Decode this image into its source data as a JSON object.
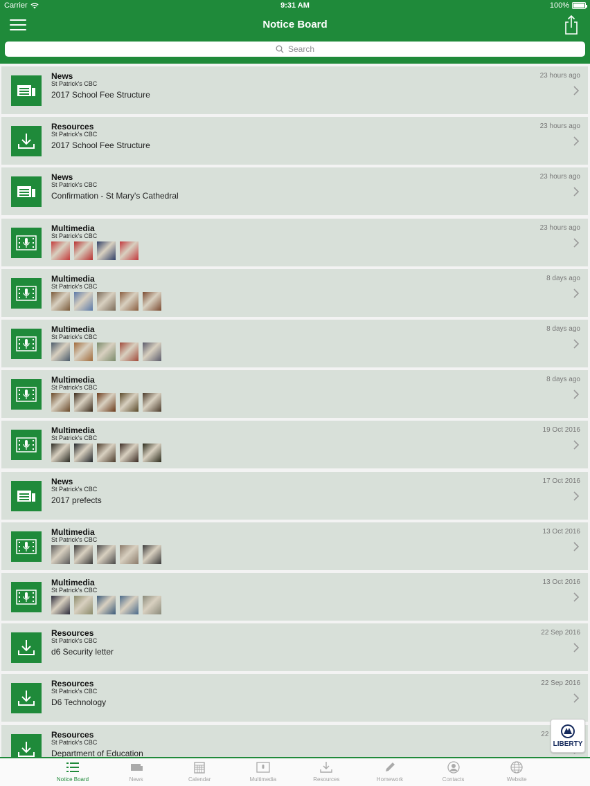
{
  "status": {
    "carrier": "Carrier",
    "time": "9:31 AM",
    "battery": "100%"
  },
  "nav": {
    "title": "Notice Board"
  },
  "search": {
    "placeholder": "Search"
  },
  "colors": {
    "brand": "#1f8a3a",
    "row_bg": "#d8e0d9"
  },
  "items": [
    {
      "type": "News",
      "icon": "news-icon",
      "source": "St Patrick's CBC",
      "title": "2017 School Fee Structure",
      "time": "23 hours ago"
    },
    {
      "type": "Resources",
      "icon": "download-icon",
      "source": "St Patrick's CBC",
      "title": "2017 School Fee Structure",
      "time": "23 hours ago"
    },
    {
      "type": "News",
      "icon": "news-icon",
      "source": "St Patrick's CBC",
      "title": "Confirmation - St Mary's Cathedral",
      "time": "23 hours ago"
    },
    {
      "type": "Multimedia",
      "icon": "multimedia-icon",
      "source": "St Patrick's CBC",
      "time": "23 hours ago",
      "thumbs": [
        "#c43a3a",
        "#b83030",
        "#2e3e66",
        "#c2383c"
      ]
    },
    {
      "type": "Multimedia",
      "icon": "multimedia-icon",
      "source": "St Patrick's CBC",
      "time": "8 days ago",
      "thumbs": [
        "#7a5a3a",
        "#5a78a8",
        "#7a6a58",
        "#8a5e40",
        "#7a4a30"
      ]
    },
    {
      "type": "Multimedia",
      "icon": "multimedia-icon",
      "source": "St Patrick's CBC",
      "time": "8 days ago",
      "thumbs": [
        "#4a5a6a",
        "#a06a3a",
        "#7a8a6a",
        "#a04a3a",
        "#5a5a6a"
      ]
    },
    {
      "type": "Multimedia",
      "icon": "multimedia-icon",
      "source": "St Patrick's CBC",
      "time": "8 days ago",
      "thumbs": [
        "#6a4a2a",
        "#3a2a1a",
        "#6a3a1a",
        "#5a4a2a",
        "#4a3a2a"
      ]
    },
    {
      "type": "Multimedia",
      "icon": "multimedia-icon",
      "source": "St Patrick's CBC",
      "time": "19 Oct 2016",
      "thumbs": [
        "#2a2a22",
        "#22262a",
        "#4a3a2a",
        "#3a2a22",
        "#2a2a1a"
      ]
    },
    {
      "type": "News",
      "icon": "news-icon",
      "source": "St Patrick's CBC",
      "title": "2017 prefects",
      "time": "17 Oct 2016"
    },
    {
      "type": "Multimedia",
      "icon": "multimedia-icon",
      "source": "St Patrick's CBC",
      "time": "13 Oct 2016",
      "thumbs": [
        "#5a5a5a",
        "#3a3a3a",
        "#4a4a4a",
        "#8a7a6a",
        "#3a3a3a"
      ]
    },
    {
      "type": "Multimedia",
      "icon": "multimedia-icon",
      "source": "St Patrick's CBC",
      "time": "13 Oct 2016",
      "thumbs": [
        "#2a2a3a",
        "#8a8a6a",
        "#3a5a7a",
        "#4a6a8a",
        "#8a8a7a"
      ]
    },
    {
      "type": "Resources",
      "icon": "download-icon",
      "source": "St Patrick's CBC",
      "title": "d6 Security letter",
      "time": "22 Sep 2016"
    },
    {
      "type": "Resources",
      "icon": "download-icon",
      "source": "St Patrick's CBC",
      "title": "D6 Technology",
      "time": "22 Sep 2016"
    },
    {
      "type": "Resources",
      "icon": "download-icon",
      "source": "St Patrick's CBC",
      "title": "Department of Education",
      "time": "22 Sep 2016"
    }
  ],
  "badge": {
    "label": "LIBERTY",
    "icon": "liberty-logo-icon"
  },
  "tabs": [
    {
      "label": "Notice Board",
      "icon": "list-icon",
      "active": true
    },
    {
      "label": "News",
      "icon": "news-tab-icon"
    },
    {
      "label": "Calendar",
      "icon": "calendar-icon"
    },
    {
      "label": "Multimedia",
      "icon": "multimedia-tab-icon"
    },
    {
      "label": "Resources",
      "icon": "download-tab-icon"
    },
    {
      "label": "Homework",
      "icon": "pencil-icon"
    },
    {
      "label": "Contacts",
      "icon": "person-icon"
    },
    {
      "label": "Website",
      "icon": "globe-icon"
    }
  ]
}
